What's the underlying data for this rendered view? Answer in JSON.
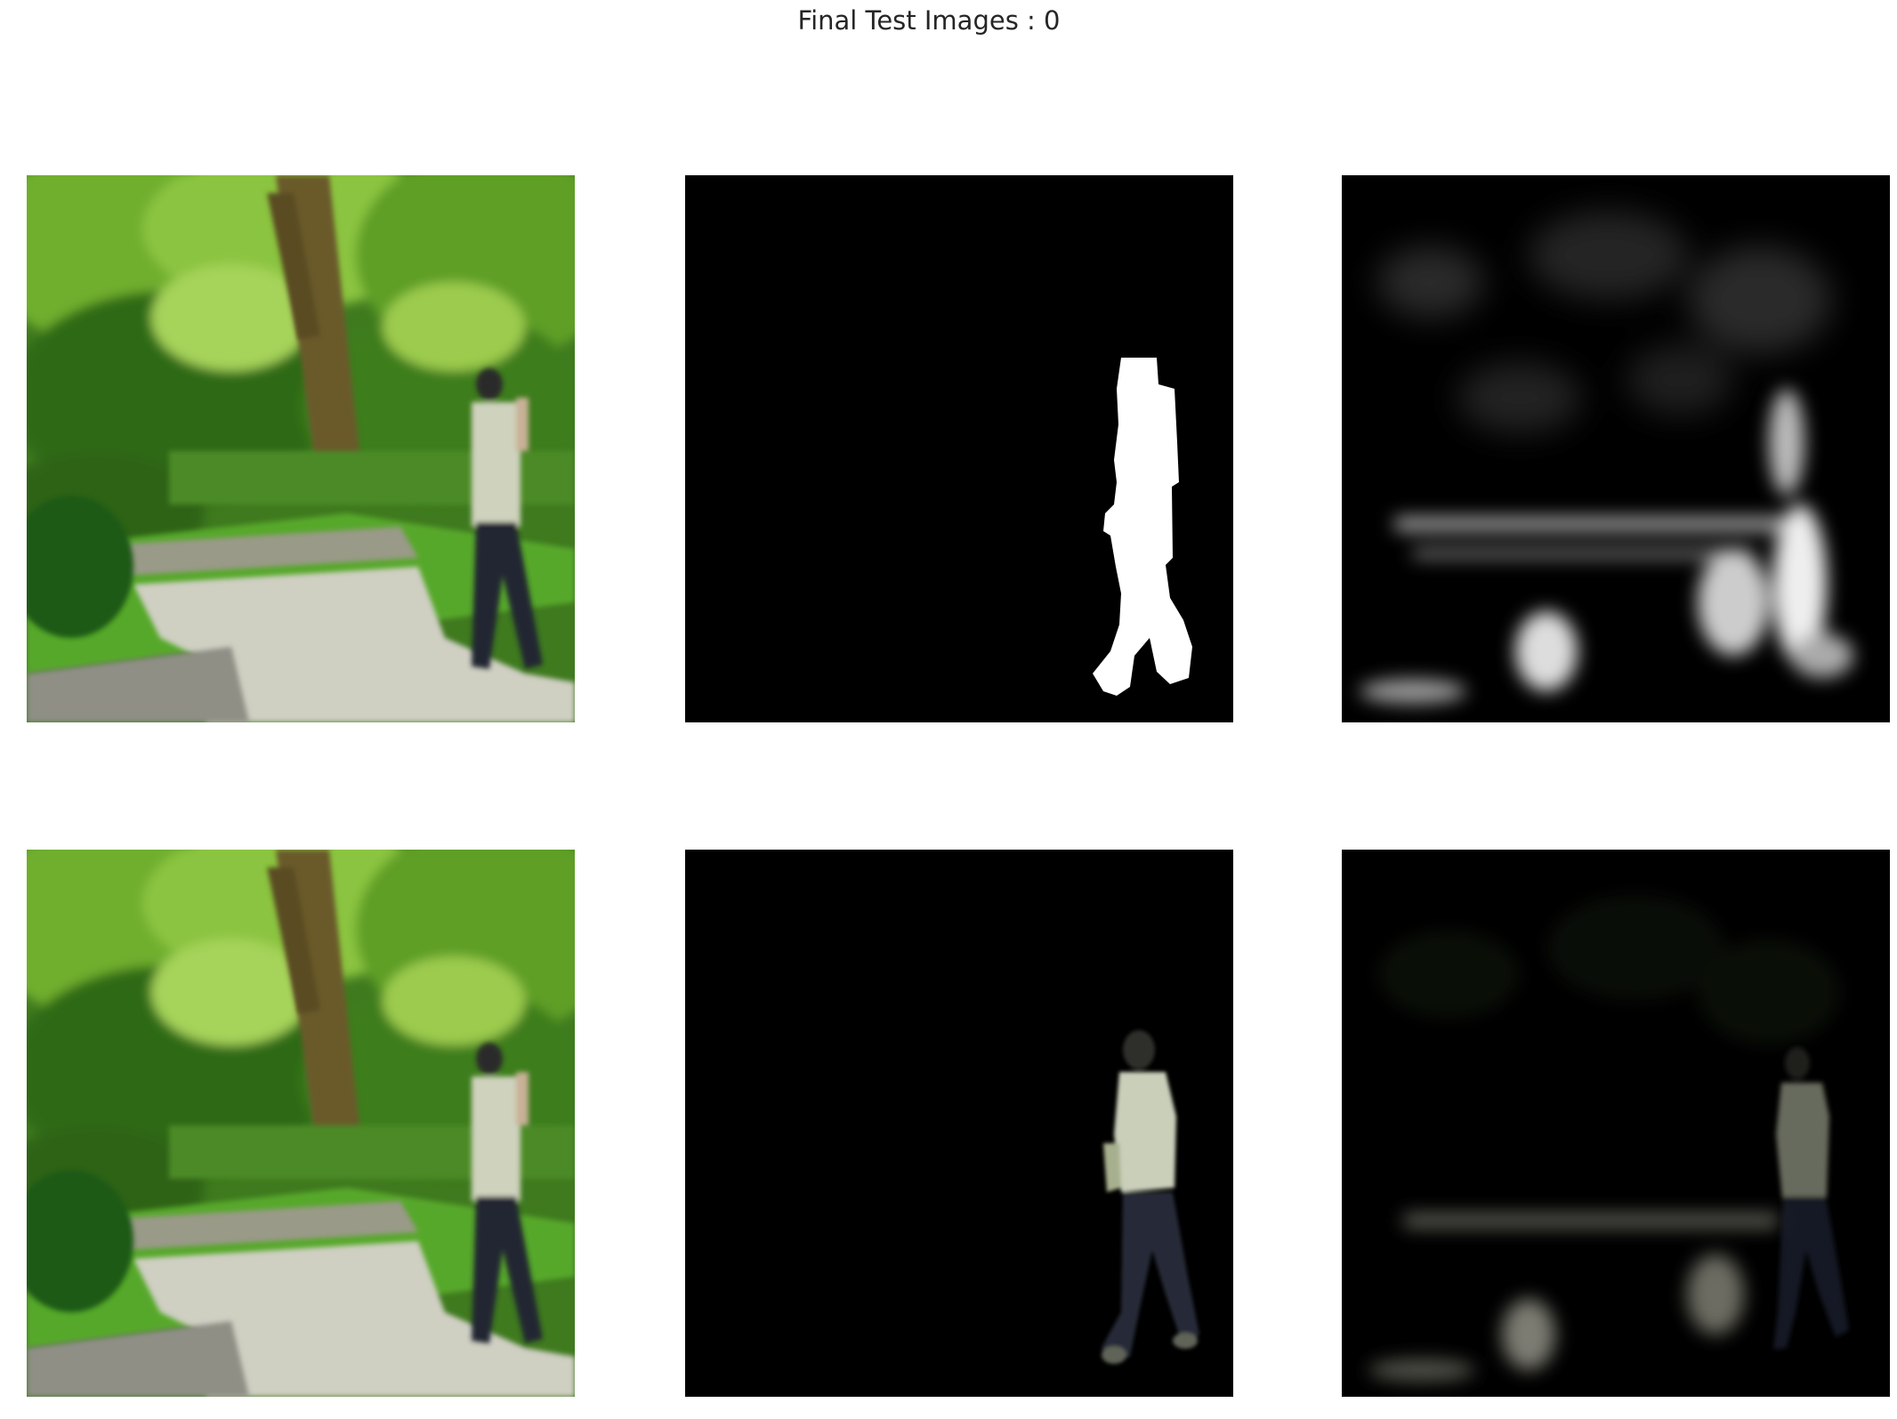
{
  "figure": {
    "title": "Final Test Images : 0"
  },
  "panels": [
    {
      "row": 1,
      "col": 1,
      "content": "input photo: park path with trees and walking person"
    },
    {
      "row": 1,
      "col": 2,
      "content": "ground-truth binary mask of person"
    },
    {
      "row": 1,
      "col": 3,
      "content": "predicted grayscale mask"
    },
    {
      "row": 2,
      "col": 1,
      "content": "input photo: park path with trees and walking person"
    },
    {
      "row": 2,
      "col": 2,
      "content": "image multiplied by ground-truth mask"
    },
    {
      "row": 2,
      "col": 3,
      "content": "image multiplied by predicted mask"
    }
  ]
}
